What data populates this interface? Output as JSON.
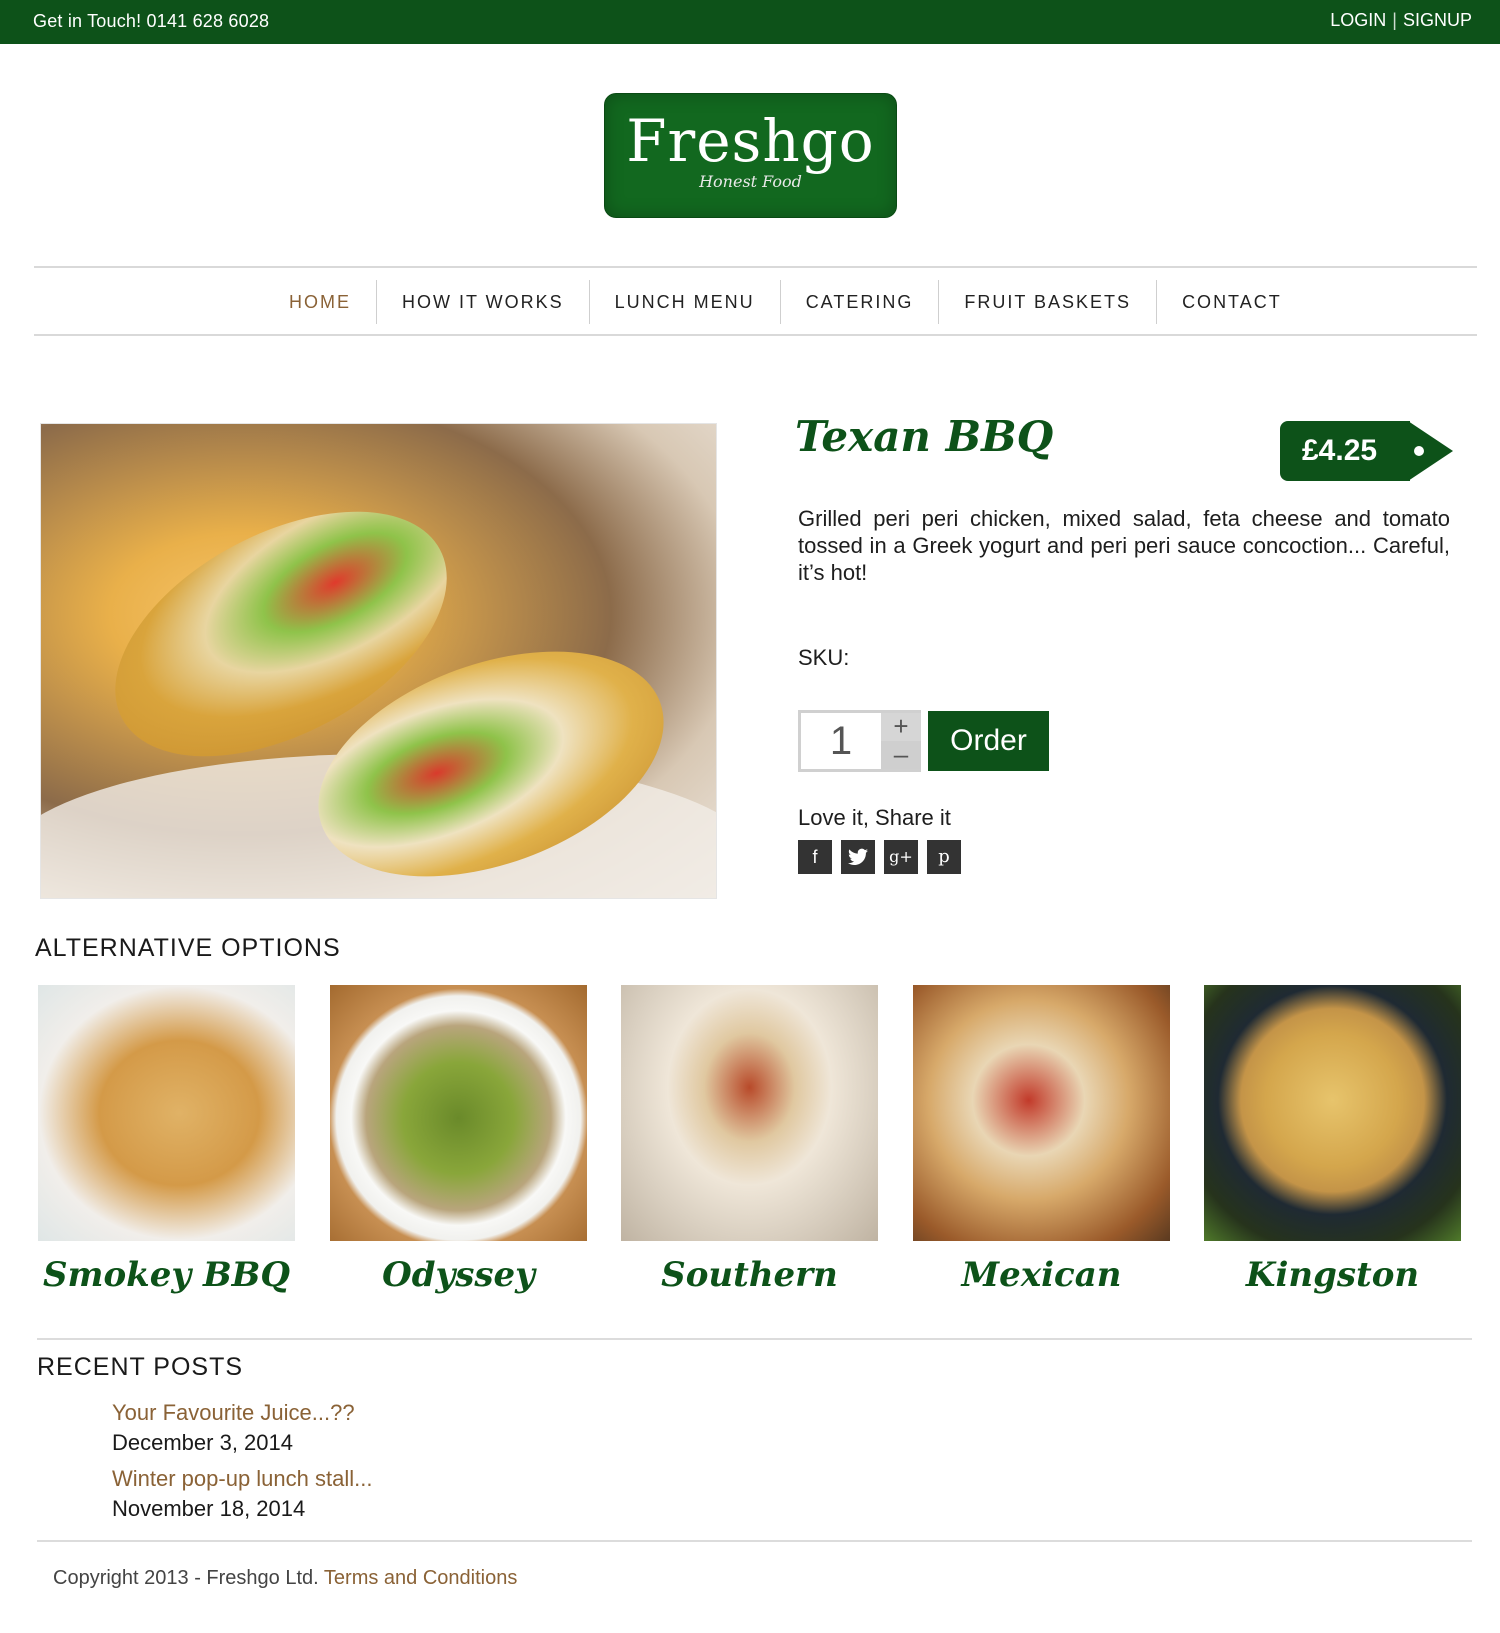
{
  "topbar": {
    "contact": "Get in Touch! 0141 628 6028",
    "login": "LOGIN",
    "separator": "|",
    "signup": "SIGNUP"
  },
  "logo": {
    "name": "Freshgo",
    "tagline": "Honest Food"
  },
  "nav": {
    "items": [
      "HOME",
      "HOW IT WORKS",
      "LUNCH MENU",
      "CATERING",
      "FRUIT BASKETS",
      "CONTACT"
    ],
    "active": "HOME"
  },
  "product": {
    "title": "Texan BBQ",
    "price": "£4.25",
    "description": "Grilled peri peri chicken, mixed salad, feta cheese and tomato tossed in a Greek yogurt and peri peri sauce concoction... Careful, it’s hot!",
    "sku_label": "SKU:",
    "quantity": "1",
    "plus": "+",
    "minus": "–",
    "order_label": "Order",
    "share_label": "Love it, Share it"
  },
  "social": [
    "facebook-icon",
    "twitter-icon",
    "google-plus-icon",
    "pinterest-icon"
  ],
  "alternatives": {
    "title": "ALTERNATIVE OPTIONS",
    "items": [
      {
        "name": "Smokey BBQ"
      },
      {
        "name": "Odyssey"
      },
      {
        "name": "Southern"
      },
      {
        "name": "Mexican"
      },
      {
        "name": "Kingston"
      }
    ]
  },
  "recent_posts": {
    "title": "RECENT POSTS",
    "posts": [
      {
        "title": "Your Favourite Juice...??",
        "date": "December 3, 2014"
      },
      {
        "title": "Winter pop-up lunch stall...",
        "date": "November 18, 2014"
      }
    ]
  },
  "footer": {
    "copyright": "Copyright 2013 - Freshgo Ltd.",
    "terms": "Terms and Conditions"
  },
  "colors": {
    "brand_green": "#0d5219",
    "link_brown": "#8a6236"
  }
}
